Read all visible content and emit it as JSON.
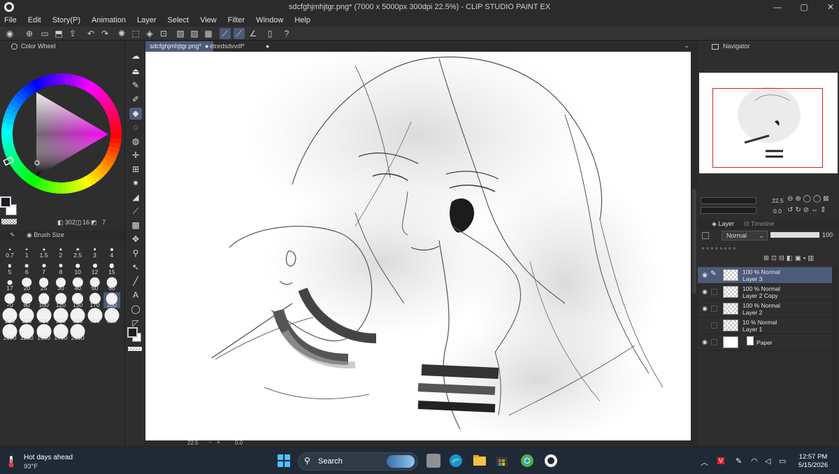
{
  "window": {
    "title": "sdcfghjmhjtgr.png* (7000 x 5000px 300dpi 22.5%)  - CLIP STUDIO PAINT EX",
    "minimize": "—",
    "maximize": "▢",
    "close": "✕"
  },
  "menu": [
    "File",
    "Edit",
    "Story(P)",
    "Animation",
    "Layer",
    "Select",
    "View",
    "Filter",
    "Window",
    "Help"
  ],
  "left_panel": {
    "color_wheel_tab": "Color Wheel",
    "color_info": {
      "h": "302",
      "s": "16",
      "v": "7"
    },
    "brush_size_tab": "Brush Size",
    "brush_sizes": [
      "0.7",
      "1",
      "1.5",
      "2",
      "2.5",
      "3",
      "4",
      "5",
      "6",
      "7",
      "8",
      "10",
      "12",
      "15",
      "17",
      "20",
      "25",
      "30",
      "40",
      "50",
      "60",
      "70",
      "80",
      "100",
      "120",
      "150",
      "170",
      "200",
      "250",
      "300",
      "400",
      "500",
      "600",
      "700",
      "800",
      "1000",
      "1200",
      "1500",
      "1700",
      "2000"
    ],
    "selected_brush_size": "200",
    "colors": {
      "main": "#1c1a22",
      "sub": "#ffffff"
    }
  },
  "canvas": {
    "tabs": [
      {
        "label": "sdcfghjmhjtgr.png*",
        "active": true
      },
      {
        "label": "étredsdvvdf*",
        "active": false
      }
    ],
    "zoom": "22.5",
    "angle": "0.0"
  },
  "right_panel": {
    "navigator_tab": "Navigator",
    "nav_zoom": "22.5",
    "nav_angle": "0.0",
    "layer_tab": "Layer",
    "timeline_tab": "Timeline",
    "opacity": "100",
    "blend_mode": "Normal",
    "layers": [
      {
        "mode": "100 % Normal",
        "name": "Layer 3",
        "selected": true,
        "visible": true,
        "type": "raster"
      },
      {
        "mode": "100 % Normal",
        "name": "Layer 2 Copy",
        "selected": false,
        "visible": true,
        "type": "raster"
      },
      {
        "mode": "100 % Normal",
        "name": "Layer 2",
        "selected": false,
        "visible": true,
        "type": "raster"
      },
      {
        "mode": "10 % Normal",
        "name": "Layer 1",
        "selected": false,
        "visible": false,
        "type": "raster"
      },
      {
        "mode": "",
        "name": "Paper",
        "selected": false,
        "visible": true,
        "type": "paper"
      }
    ]
  },
  "taskbar": {
    "weather_title": "Hot days ahead",
    "weather_temp": "93°F",
    "search_label": "Search",
    "time": "12:57 PM",
    "date": "5/15/2026"
  }
}
